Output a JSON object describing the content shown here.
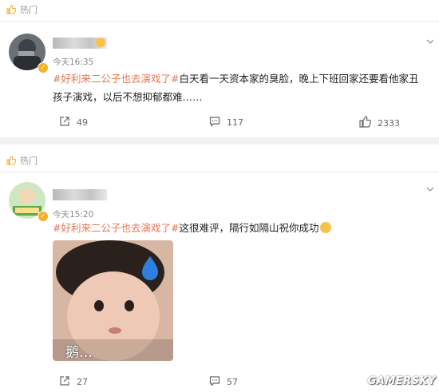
{
  "posts": [
    {
      "hot_label": "热门",
      "time": "今天16:35",
      "hashtag": "#好利来二公子也去演戏了#",
      "text": "白天看一天资本家的臭脸，晚上下班回家还要看他家丑孩子演戏，以后不想抑郁都难……",
      "share_count": "49",
      "comment_count": "117",
      "like_count": "2333"
    },
    {
      "hot_label": "热门",
      "time": "今天15:20",
      "hashtag": "#好利来二公子也去演戏了#",
      "text": "这很难评，隔行如隔山祝你成功",
      "image_caption": "鹅…",
      "share_count": "27",
      "comment_count": "57"
    }
  ],
  "watermark": "GAMERSKY",
  "colors": {
    "hashtag": "#eb7350",
    "hot": "#f3a72b",
    "badge": "#f6b023",
    "meta": "#8a8a8a"
  }
}
